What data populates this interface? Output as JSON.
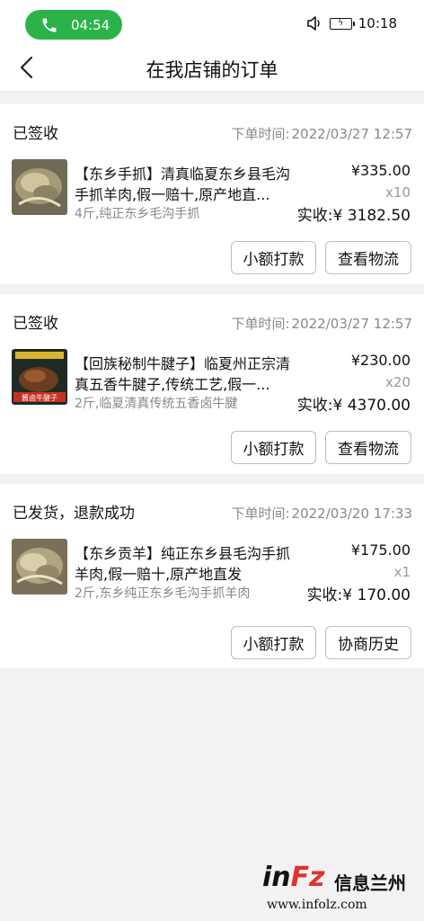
{
  "status_bar": {
    "call_time": "04:54",
    "clock": "10:18"
  },
  "nav": {
    "title": "在我店铺的订单"
  },
  "orders": [
    {
      "status": "已签收",
      "time_label": "下单时间:",
      "time": "2022/03/27 12:57",
      "title": "【东乡手抓】清真临夏东乡县毛沟手抓羊肉,假一赔十,原产地直...",
      "desc": "4斤,纯正东乡毛沟手抓",
      "price": "¥335.00",
      "qty": "x10",
      "paid": "实收:¥ 3182.50",
      "buttons": [
        "小额打款",
        "查看物流"
      ]
    },
    {
      "status": "已签收",
      "time_label": "下单时间:",
      "time": "2022/03/27 12:57",
      "title": "【回族秘制牛腱子】临夏州正宗清真五香牛腱子,传统工艺,假一...",
      "desc": "2斤,临夏清真传统五香卤牛腱",
      "price": "¥230.00",
      "qty": "x20",
      "paid": "实收:¥ 4370.00",
      "thumb_text": "酱卤牛腱子",
      "buttons": [
        "小额打款",
        "查看物流"
      ]
    },
    {
      "status": "已发货，退款成功",
      "time_label": "下单时间:",
      "time": "2022/03/20 17:33",
      "title": "【东乡贡羊】纯正东乡县毛沟手抓羊肉,假一赔十,原产地直发",
      "desc": "2斤,东乡纯正东乡毛沟手抓羊肉",
      "price": "¥175.00",
      "qty": "x1",
      "paid": "实收:¥ 170.00",
      "buttons": [
        "小额打款",
        "协商历史"
      ]
    }
  ],
  "watermark": {
    "logo_a": "in",
    "logo_b": "F",
    "logo_c": "z",
    "cn": "信息兰州",
    "url": "www.infolz.com"
  },
  "colors": {
    "call_green": "#2bb34a",
    "page_bg": "#f2f2f2"
  }
}
